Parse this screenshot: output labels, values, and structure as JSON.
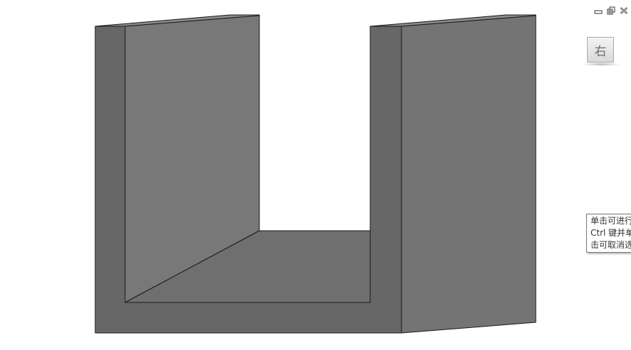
{
  "window_controls": {
    "minimize_icon": "minimize-icon",
    "restore_icon": "restore-icon",
    "close_icon": "close-icon"
  },
  "view_cube": {
    "face_label": "右"
  },
  "tooltip": {
    "lines": [
      "单击可进行",
      "Ctrl 键并单",
      "击可取消选"
    ]
  },
  "colors": {
    "background": "#ffffff",
    "model_front": "#686868",
    "model_inner": "#767676",
    "model_floor": "#707070",
    "edge": "#1a1a1a"
  }
}
